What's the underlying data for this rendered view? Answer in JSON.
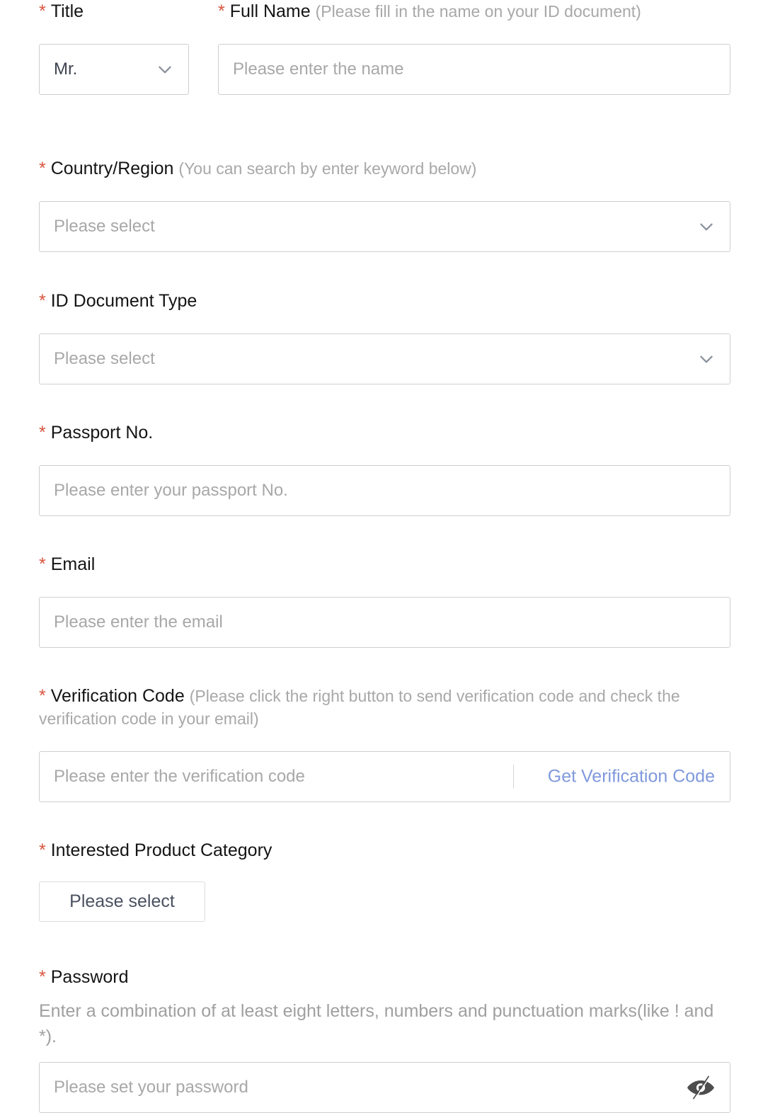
{
  "form": {
    "fields": {
      "title": {
        "label": "Title",
        "required_mark": "*",
        "value": "Mr.",
        "chevron_icon": "chevron-down-icon"
      },
      "full_name": {
        "label": "Full Name",
        "required_mark": "*",
        "hint": "(Please fill in the name on your ID document)",
        "placeholder": "Please enter the name",
        "value": ""
      },
      "country_region": {
        "label": "Country/Region",
        "required_mark": "*",
        "hint": "(You can search by enter keyword below)",
        "placeholder": "Please select",
        "value": "",
        "chevron_icon": "chevron-down-icon"
      },
      "id_document_type": {
        "label": "ID Document Type",
        "required_mark": "*",
        "hint": "",
        "placeholder": "Please select",
        "value": "",
        "chevron_icon": "chevron-down-icon"
      },
      "passport_no": {
        "label": "Passport No.",
        "required_mark": "*",
        "placeholder": "Please enter your passport No.",
        "value": ""
      },
      "email": {
        "label": "Email",
        "required_mark": "*",
        "placeholder": "Please enter the email",
        "value": ""
      },
      "verification_code": {
        "label": "Verification Code",
        "required_mark": "*",
        "hint": "(Please click the right button to send verification code and check the verification code in your email)",
        "placeholder": "Please enter the verification code",
        "value": "",
        "action_label": "Get Verification Code"
      },
      "interested_product_category": {
        "label": "Interested Product Category",
        "required_mark": "*",
        "button_label": "Please select"
      },
      "password": {
        "label": "Password",
        "required_mark": "*",
        "help_text": "Enter a combination of at least eight letters, numbers and punctuation marks(like ! and *).",
        "placeholder": "Please set your password",
        "value": "",
        "toggle_icon": "eye-off-icon"
      }
    }
  },
  "colors": {
    "required_star": "#d9553f",
    "label": "#141414",
    "hint": "#a8a8a8",
    "placeholder": "#a8a8a8",
    "input_border": "#cfcfcf",
    "link": "#8099dd",
    "value_text": "#3d4450",
    "background": "#ffffff"
  }
}
